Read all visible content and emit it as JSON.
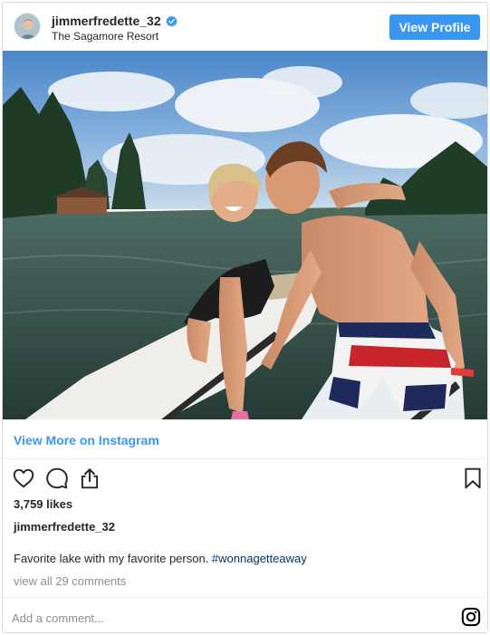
{
  "header": {
    "username": "jimmerfredette_32",
    "verified_icon": "verified-badge-icon",
    "location": "The Sagamore Resort",
    "view_profile_label": "View Profile",
    "accent_color": "#3897f0"
  },
  "post": {
    "image_alt": "Couple on paddle boards on a lake",
    "view_more_label": "View More on Instagram",
    "likes": "3,759 likes",
    "author": "jimmerfredette_32",
    "caption_text": "Favorite lake with my favorite person. ",
    "caption_hashtag": "#wonnagetteaway",
    "comments_link": "view all 29 comments"
  },
  "actions": {
    "like_icon": "heart-icon",
    "comment_icon": "comment-icon",
    "share_icon": "share-icon",
    "save_icon": "bookmark-icon"
  },
  "footer": {
    "add_comment_placeholder": "Add a comment...",
    "logo_icon": "instagram-icon"
  }
}
